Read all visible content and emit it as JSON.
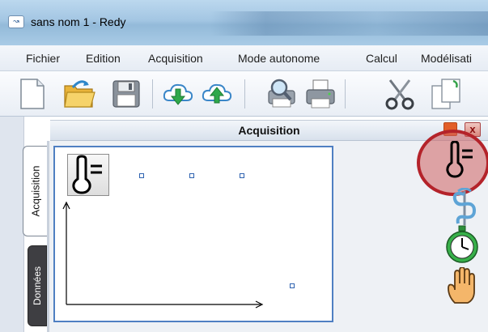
{
  "window": {
    "title": "sans nom 1 - Redy",
    "icon_glyph": "↝"
  },
  "menu": {
    "items": [
      {
        "label": "Fichier"
      },
      {
        "label": "Edition"
      },
      {
        "label": "Acquisition"
      },
      {
        "label": "Mode autonome"
      },
      {
        "label": "Calcul"
      },
      {
        "label": "Modélisati"
      }
    ]
  },
  "toolbar": {
    "buttons": [
      {
        "icon": "new-document-icon"
      },
      {
        "icon": "open-folder-icon"
      },
      {
        "icon": "save-disk-icon"
      },
      {
        "icon": "download-cloud-icon"
      },
      {
        "icon": "upload-cloud-icon"
      },
      {
        "icon": "print-preview-icon"
      },
      {
        "icon": "printer-icon"
      },
      {
        "icon": "scissors-icon"
      },
      {
        "icon": "copy-icon"
      }
    ]
  },
  "side_tabs": {
    "acquisition": "Acquisition",
    "donnees": "Données"
  },
  "panel": {
    "title": "Acquisition",
    "close_glyph": "x"
  },
  "right_tools": [
    {
      "icon": "thermometer-icon",
      "highlighted": true
    },
    {
      "icon": "caduceus-icon",
      "highlighted": false
    },
    {
      "icon": "stopwatch-icon",
      "highlighted": false
    },
    {
      "icon": "hand-icon",
      "highlighted": false
    }
  ],
  "colors": {
    "highlight_ring": "#b4232a",
    "canvas_border": "#4f7fc2",
    "close_button": "#d9877d",
    "minimize_button": "#e25f28"
  }
}
